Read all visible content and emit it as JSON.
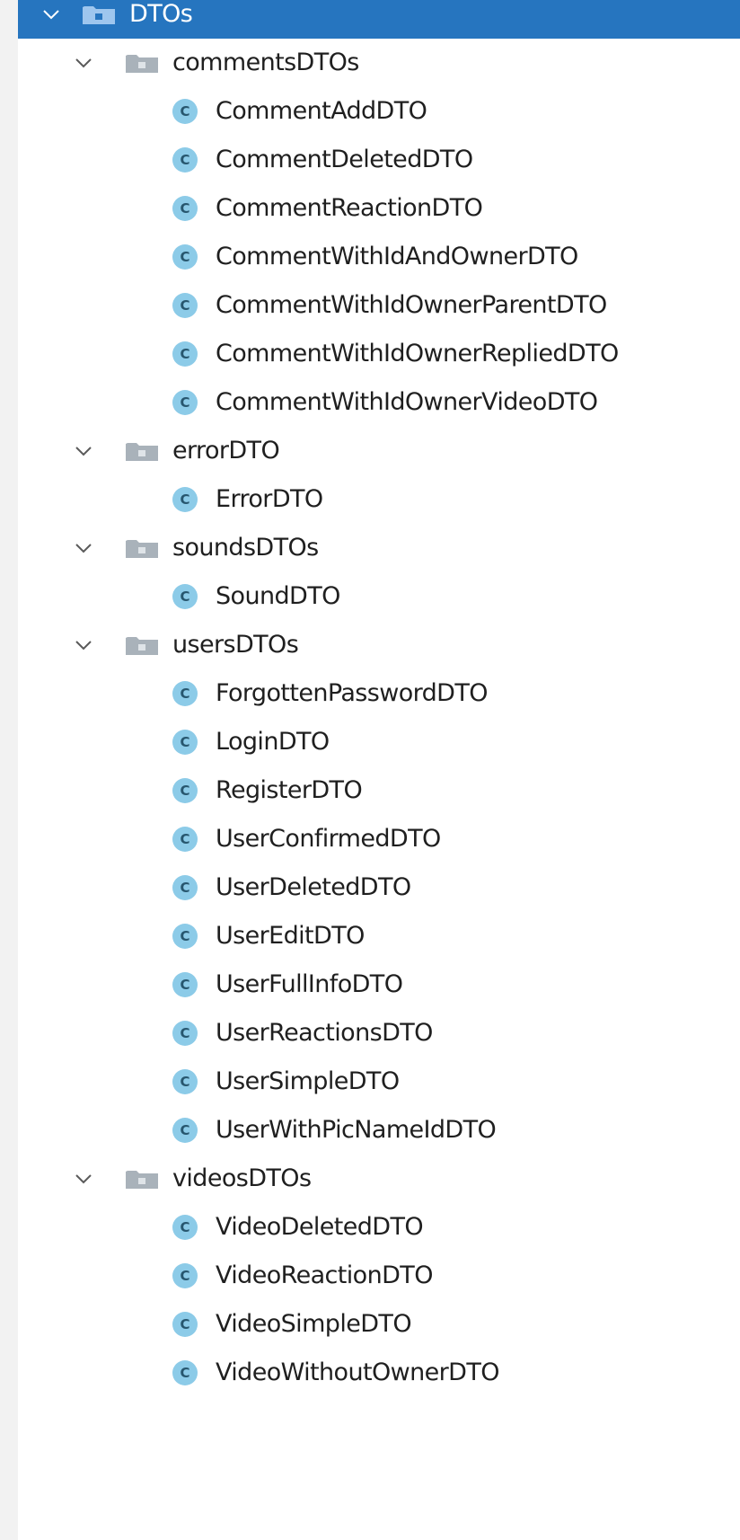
{
  "tree": {
    "root": {
      "label": "DTOs",
      "expanded": true,
      "selected": true,
      "children": [
        {
          "label": "commentsDTOs",
          "expanded": true,
          "children": [
            "CommentAddDTO",
            "CommentDeletedDTO",
            "CommentReactionDTO",
            "CommentWithIdAndOwnerDTO",
            "CommentWithIdOwnerParentDTO",
            "CommentWithIdOwnerRepliedDTO",
            "CommentWithIdOwnerVideoDTO"
          ]
        },
        {
          "label": "errorDTO",
          "expanded": true,
          "children": [
            "ErrorDTO"
          ]
        },
        {
          "label": "soundsDTOs",
          "expanded": true,
          "children": [
            "SoundDTO"
          ]
        },
        {
          "label": "usersDTOs",
          "expanded": true,
          "children": [
            "ForgottenPasswordDTO",
            "LoginDTO",
            "RegisterDTO",
            "UserConfirmedDTO",
            "UserDeletedDTO",
            "UserEditDTO",
            "UserFullInfoDTO",
            "UserReactionsDTO",
            "UserSimpleDTO",
            "UserWithPicNameIdDTO"
          ]
        },
        {
          "label": "videosDTOs",
          "expanded": true,
          "children": [
            "VideoDeletedDTO",
            "VideoReactionDTO",
            "VideoSimpleDTO",
            "VideoWithoutOwnerDTO"
          ]
        }
      ]
    },
    "icons": {
      "expand": "chevron-down-icon",
      "package": "package-folder-icon",
      "class": "class-icon",
      "class_letter": "C"
    },
    "colors": {
      "selection": "#2675bf",
      "folder": "#a9b2ba",
      "class_badge": "#8ccbe8",
      "class_letter": "#27566e",
      "text": "#1f1f1f"
    }
  }
}
